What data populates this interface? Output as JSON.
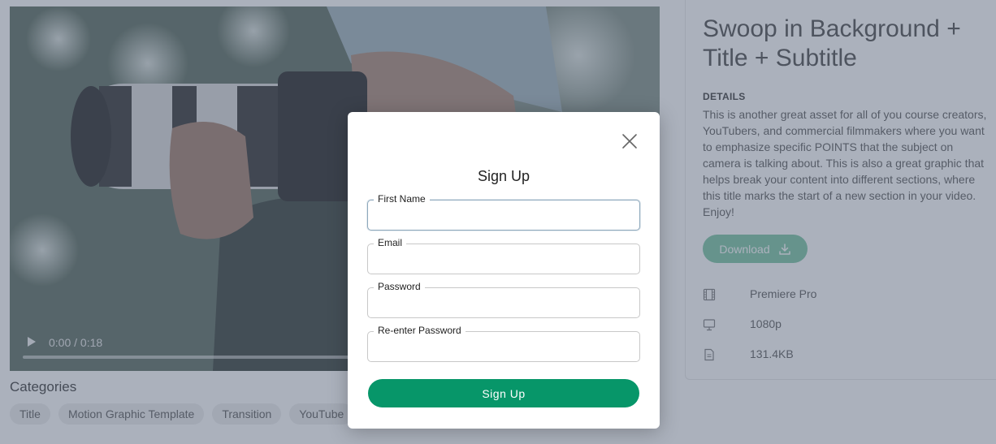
{
  "video": {
    "time": "0:00 / 0:18",
    "progress": 0
  },
  "categories": {
    "title": "Categories",
    "tags": [
      "Title",
      "Motion Graphic Template",
      "Transition",
      "YouTube"
    ]
  },
  "asset": {
    "title": "Swoop in Background + Title + Subtitle",
    "details_label": "DETAILS",
    "details_text": "This is another great asset for all of you course creators, YouTubers, and commercial filmmakers where you want to emphasize specific POINTS that the subject on camera is talking about. This is also a great graphic that helps break your content into different sections, where this title marks the start of a new section in your video. Enjoy!",
    "download_label": "Download",
    "specs": [
      {
        "icon": "film-icon",
        "value": "Premiere Pro"
      },
      {
        "icon": "monitor-icon",
        "value": "1080p"
      },
      {
        "icon": "file-icon",
        "value": "131.4KB"
      }
    ]
  },
  "modal": {
    "title": "Sign Up",
    "fields": [
      {
        "label": "First Name",
        "value": "",
        "active": true
      },
      {
        "label": "Email",
        "value": ""
      },
      {
        "label": "Password",
        "value": ""
      },
      {
        "label": "Re-enter Password",
        "value": ""
      }
    ],
    "submit_label": "Sign Up"
  },
  "colors": {
    "accent": "#079669",
    "download_button": "#74c29f",
    "overlay": "#58647a"
  }
}
